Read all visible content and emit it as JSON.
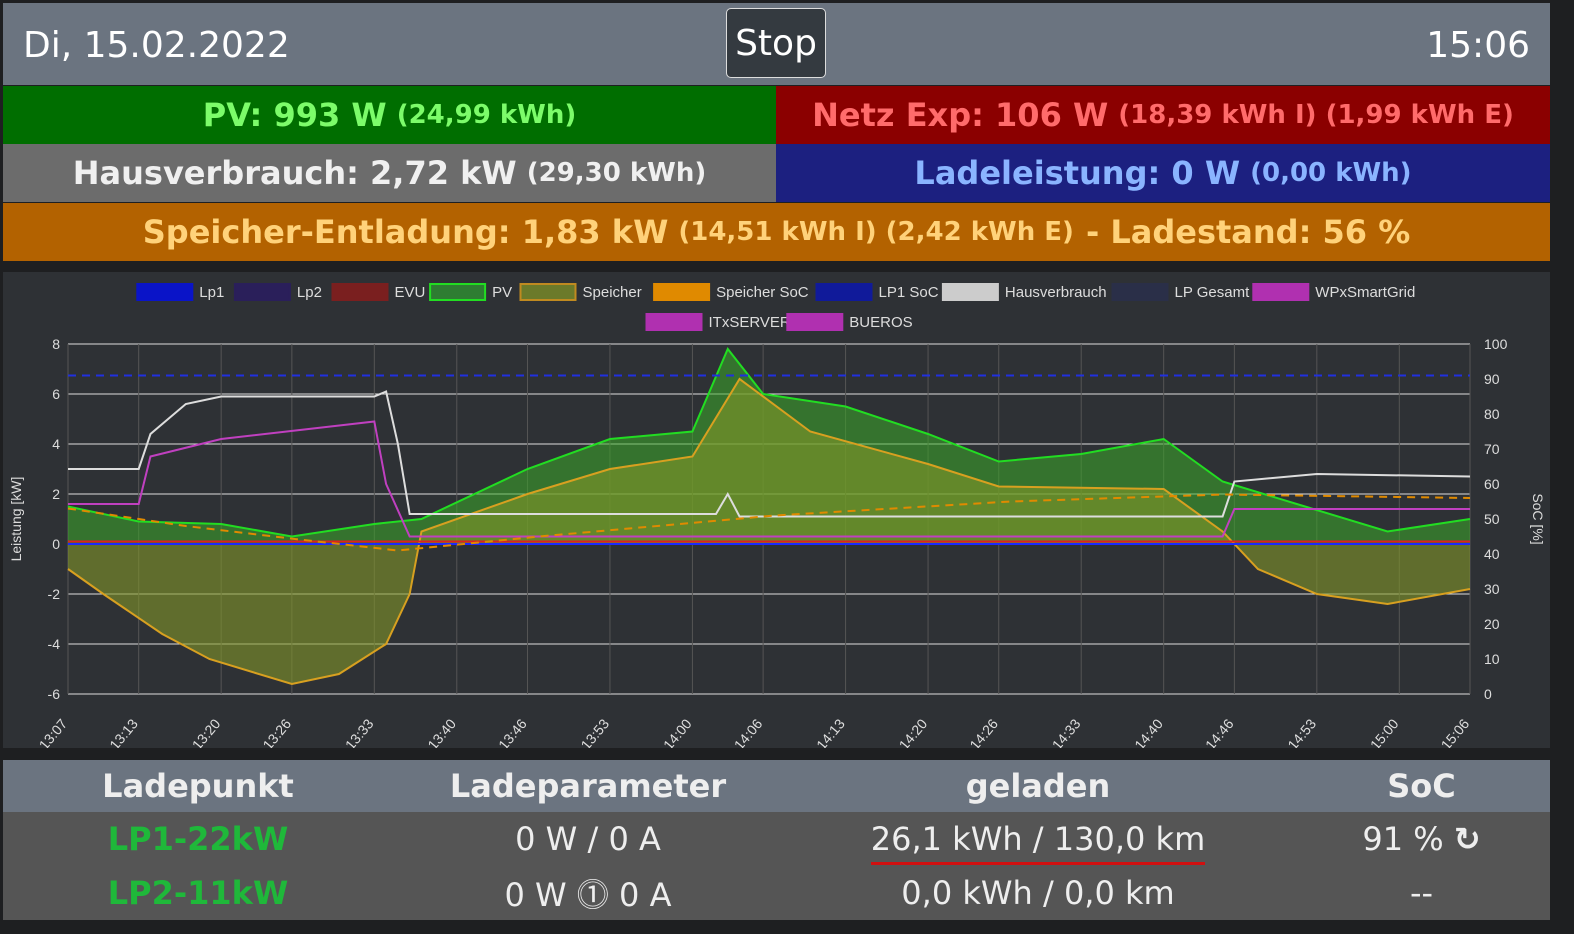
{
  "header": {
    "date": "Di, 15.02.2022",
    "stop_label": "Stop",
    "time": "15:06"
  },
  "summary": {
    "pv": {
      "label": "PV: 993 W",
      "sub": "(24,99 kWh)",
      "color": "#006e00",
      "text": "#7cfc6a"
    },
    "netz": {
      "label": "Netz Exp: 106 W",
      "sub": "(18,39 kWh I) (1,99 kWh E)",
      "color": "#8b0000",
      "text": "#ff6b6b"
    },
    "haus": {
      "label": "Hausverbrauch: 2,72 kW",
      "sub": "(29,30 kWh)",
      "color": "#6c6c6c",
      "text": "#f0f0f0"
    },
    "lade": {
      "label": "Ladeleistung: 0 W",
      "sub": "(0,00 kWh)",
      "color": "#1c2080",
      "text": "#8ab4ff"
    },
    "speicher": {
      "label": "Speicher-Entladung: 1,83 kW",
      "sub": "(14,51 kWh I) (2,42 kWh E)",
      "tail": "- Ladestand: 56 %",
      "color": "#b36200",
      "text": "#ffd27a"
    }
  },
  "chart_data": {
    "type": "line",
    "ylabel": "Leistung [kW]",
    "y2label": "SoC [%]",
    "ylim": [
      -6,
      8
    ],
    "y2lim": [
      0,
      100
    ],
    "yticks": [
      "8",
      "6",
      "4",
      "2",
      "0",
      "-2",
      "-4",
      "-6"
    ],
    "y2ticks": [
      "100",
      "90",
      "80",
      "70",
      "60",
      "50",
      "40",
      "30",
      "20",
      "10",
      "0"
    ],
    "xticks": [
      "13:07",
      "13:13",
      "13:20",
      "13:26",
      "13:33",
      "13:40",
      "13:46",
      "13:53",
      "14:00",
      "14:06",
      "14:13",
      "14:20",
      "14:26",
      "14:33",
      "14:40",
      "14:46",
      "14:53",
      "15:00",
      "15:06"
    ],
    "xrange_minutes": [
      0,
      119
    ],
    "legend": [
      {
        "name": "Lp1",
        "color": "#0a14c8"
      },
      {
        "name": "Lp2",
        "color": "#2a1f5a"
      },
      {
        "name": "EVU",
        "color": "#7a1f1f"
      },
      {
        "name": "PV",
        "color": "#2e7d32",
        "border": "#22dd22"
      },
      {
        "name": "Speicher",
        "color": "#6b7a2a",
        "border": "#c08a20"
      },
      {
        "name": "Speicher SoC",
        "color": "#e08a00"
      },
      {
        "name": "LP1 SoC",
        "color": "#101a9a"
      },
      {
        "name": "Hausverbrauch",
        "color": "#cccccc"
      },
      {
        "name": "LP Gesamt",
        "color": "#2a2f48"
      },
      {
        "name": "WPxSmartGrid",
        "color": "#b030b0"
      },
      {
        "name": "ITxSERVER",
        "color": "#b030b0"
      },
      {
        "name": "BUEROS",
        "color": "#b030b0"
      }
    ],
    "series": [
      {
        "name": "PV",
        "axis": "kW",
        "fill": "rgba(60,170,40,0.55)",
        "stroke": "#22dd22",
        "points": [
          [
            0,
            1.5
          ],
          [
            6,
            0.9
          ],
          [
            13,
            0.8
          ],
          [
            19,
            0.3
          ],
          [
            26,
            0.8
          ],
          [
            30,
            1
          ],
          [
            39,
            3
          ],
          [
            46,
            4.2
          ],
          [
            53,
            4.5
          ],
          [
            56,
            7.8
          ],
          [
            59,
            6
          ],
          [
            66,
            5.5
          ],
          [
            73,
            4.4
          ],
          [
            79,
            3.3
          ],
          [
            86,
            3.6
          ],
          [
            93,
            4.2
          ],
          [
            98,
            2.5
          ],
          [
            105,
            1.5
          ],
          [
            112,
            0.5
          ],
          [
            119,
            1
          ]
        ]
      },
      {
        "name": "Speicher",
        "axis": "kW",
        "fill": "rgba(130,150,40,0.6)",
        "stroke": "#d8a020",
        "points": [
          [
            0,
            -1
          ],
          [
            3,
            -2
          ],
          [
            8,
            -3.6
          ],
          [
            12,
            -4.6
          ],
          [
            19,
            -5.6
          ],
          [
            23,
            -5.2
          ],
          [
            27,
            -4
          ],
          [
            29,
            -2
          ],
          [
            30,
            0.5
          ],
          [
            39,
            2
          ],
          [
            46,
            3
          ],
          [
            53,
            3.5
          ],
          [
            57,
            6.6
          ],
          [
            63,
            4.5
          ],
          [
            73,
            3.2
          ],
          [
            79,
            2.3
          ],
          [
            93,
            2.2
          ],
          [
            98,
            0.5
          ],
          [
            101,
            -1
          ],
          [
            106,
            -2
          ],
          [
            112,
            -2.4
          ],
          [
            119,
            -1.8
          ]
        ]
      },
      {
        "name": "Hausverbrauch",
        "axis": "kW",
        "stroke": "#dddddd",
        "points": [
          [
            0,
            3
          ],
          [
            6,
            3
          ],
          [
            7,
            4.4
          ],
          [
            10,
            5.6
          ],
          [
            13,
            5.9
          ],
          [
            26,
            5.9
          ],
          [
            27,
            6.1
          ],
          [
            28,
            4
          ],
          [
            29,
            1.2
          ],
          [
            40,
            1.2
          ],
          [
            55,
            1.2
          ],
          [
            56,
            2
          ],
          [
            57,
            1.1
          ],
          [
            98,
            1.1
          ],
          [
            99,
            2.5
          ],
          [
            106,
            2.8
          ],
          [
            119,
            2.7
          ]
        ]
      },
      {
        "name": "WPxSmartGrid",
        "axis": "kW",
        "stroke": "#c040c0",
        "points": [
          [
            0,
            1.6
          ],
          [
            6,
            1.6
          ],
          [
            7,
            3.5
          ],
          [
            13,
            4.2
          ],
          [
            26,
            4.9
          ],
          [
            27,
            2.4
          ],
          [
            29,
            0.3
          ],
          [
            98,
            0.3
          ],
          [
            99,
            1.4
          ],
          [
            119,
            1.4
          ]
        ]
      },
      {
        "name": "EVU",
        "axis": "kW",
        "stroke": "#e02020",
        "points": [
          [
            0,
            0.1
          ],
          [
            119,
            0.1
          ]
        ]
      },
      {
        "name": "Lp1",
        "axis": "kW",
        "stroke": "#1a2aff",
        "points": [
          [
            0,
            0
          ],
          [
            119,
            0
          ]
        ]
      },
      {
        "name": "Speicher SoC",
        "axis": "soc",
        "stroke": "#e08a00",
        "dash": "8,6",
        "points": [
          [
            0,
            53
          ],
          [
            10,
            48
          ],
          [
            20,
            44
          ],
          [
            28,
            41
          ],
          [
            40,
            45
          ],
          [
            60,
            51
          ],
          [
            80,
            55
          ],
          [
            98,
            57
          ],
          [
            119,
            56
          ]
        ]
      },
      {
        "name": "LP1 SoC",
        "axis": "soc",
        "stroke": "#2030e0",
        "dash": "8,6",
        "points": [
          [
            0,
            91
          ],
          [
            119,
            91
          ]
        ]
      }
    ]
  },
  "table": {
    "headers": [
      "Ladepunkt",
      "Ladeparameter",
      "geladen",
      "SoC"
    ],
    "rows": [
      {
        "name": "LP1-22kW",
        "param": "0 W / 0 A",
        "charged": "26,1 kWh / 130,0 km",
        "soc": "91 %",
        "icon": "↻"
      },
      {
        "name": "LP2-11kW",
        "param": "0 W ⓵ 0 A",
        "charged": "0,0 kWh / 0,0 km",
        "soc": "--"
      }
    ]
  }
}
